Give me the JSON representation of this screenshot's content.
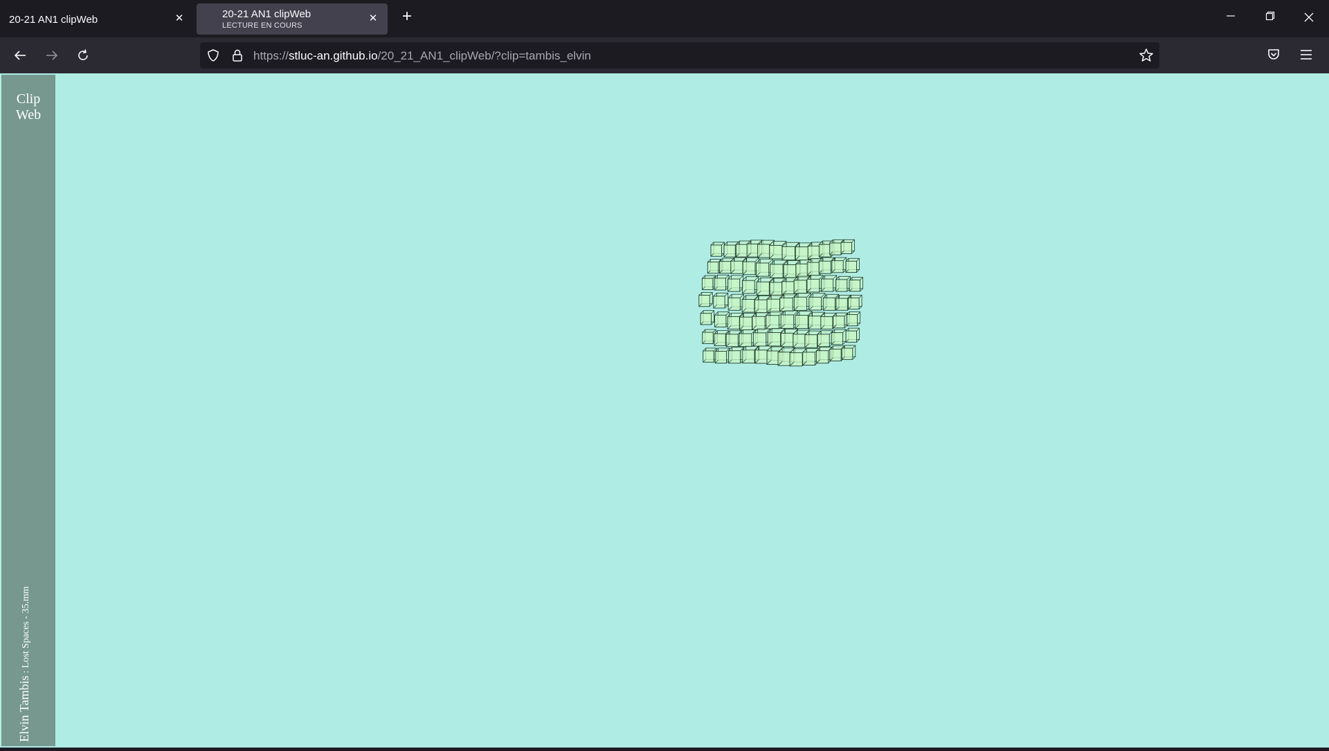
{
  "window": {
    "tabs": [
      {
        "title": "20-21 AN1 clipWeb",
        "active": false
      },
      {
        "title": "20-21 AN1 clipWeb",
        "subtitle": "LECTURE EN COURS",
        "active": true
      }
    ],
    "controls": {
      "minimize_icon": "minimize-icon",
      "restore_icon": "restore-icon",
      "close_icon": "close-icon"
    }
  },
  "toolbar": {
    "url": {
      "scheme": "https://",
      "host": "stluc-an.github.io",
      "path": "/20_21_AN1_clipWeb/?clip=tambis_elvin"
    }
  },
  "page": {
    "background_color": "#afece4",
    "sidebar_color": "#76988e",
    "logo": {
      "line1": "Clip",
      "line2": "Web"
    },
    "credit": {
      "name": "Elvin Tambis",
      "rest": " : Lost Spaces - 35.mm"
    },
    "scene": {
      "object": "wireframe cube cluster",
      "cube_fill": "#c8f5c4",
      "cube_stroke": "#1f3a2a"
    }
  }
}
